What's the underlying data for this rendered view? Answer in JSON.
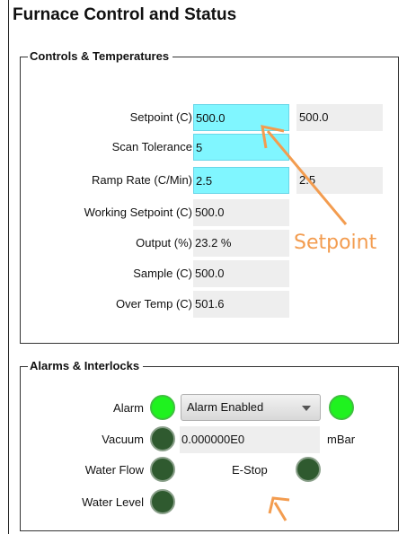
{
  "title": "Furnace Control and Status",
  "controls": {
    "legend": "Controls & Temperatures",
    "setpoint": {
      "label": "Setpoint (C)",
      "value": "500.0",
      "readback": "500.0"
    },
    "scan_tolerance": {
      "label": "Scan Tolerance",
      "value": "5"
    },
    "ramp_rate": {
      "label": "Ramp Rate (C/Min)",
      "value": "2.5",
      "readback": "2.5"
    },
    "working_setpoint": {
      "label": "Working Setpoint (C)",
      "value": "500.0"
    },
    "output": {
      "label": "Output (%)",
      "value": "23.2 %"
    },
    "sample": {
      "label": "Sample (C)",
      "value": "500.0"
    },
    "over_temp": {
      "label": "Over Temp (C)",
      "value": "501.6"
    }
  },
  "alarms": {
    "legend": "Alarms & Interlocks",
    "alarm": {
      "label": "Alarm",
      "state": "on",
      "select_value": "Alarm Enabled",
      "state2": "on"
    },
    "vacuum": {
      "label": "Vacuum",
      "state": "off",
      "value": "0.000000E0",
      "unit": "mBar"
    },
    "water_flow": {
      "label": "Water Flow",
      "state": "off"
    },
    "estop": {
      "label": "E-Stop",
      "state": "off"
    },
    "water_level": {
      "label": "Water Level",
      "state": "off"
    }
  },
  "annotation": {
    "text": "Setpoint",
    "color": "#f39c4f"
  },
  "colors": {
    "input_bg": "#80f6ff",
    "readonly_bg": "#eeeeee",
    "led_on": "#1ff21f",
    "led_off": "#2f5a2f"
  }
}
